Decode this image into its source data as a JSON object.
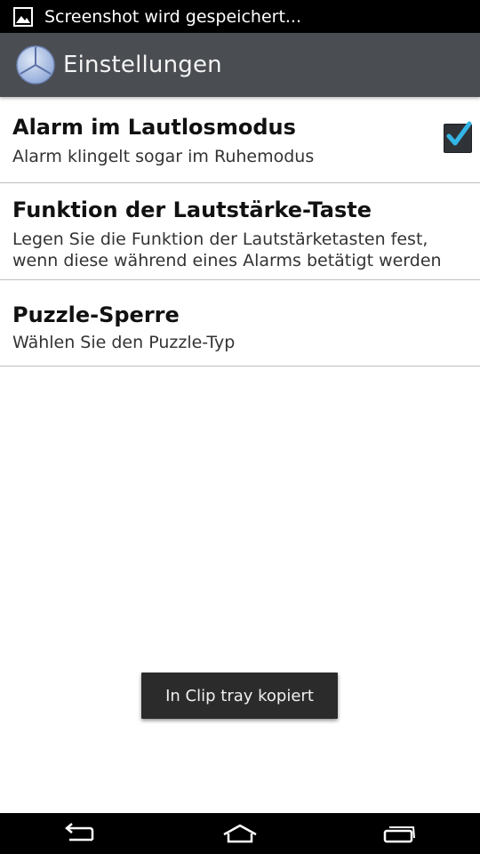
{
  "status_bar": {
    "notification_icon": "image-icon",
    "text": "Screenshot wird gespeichert..."
  },
  "action_bar": {
    "app_icon": "clock-app-icon",
    "title": "Einstellungen"
  },
  "preferences": [
    {
      "title": "Alarm im Lautlosmodus",
      "summary": "Alarm klingelt sogar im Ruhemodus",
      "checked": true
    },
    {
      "title": "Funktion der Lautstärke-Taste",
      "summary": "Legen Sie die Funktion der Lautstärketasten fest, wenn diese während eines Alarms betätigt werden"
    },
    {
      "title": "Puzzle-Sperre",
      "summary": "Wählen Sie den Puzzle-Typ"
    }
  ],
  "toast": {
    "text": "In Clip tray kopiert"
  },
  "nav_bar": {
    "back_icon": "back-icon",
    "home_icon": "home-icon",
    "recents_icon": "recent-apps-icon"
  },
  "colors": {
    "action_bar": "#4a4d52",
    "checkbox_check": "#33b5e5",
    "toast_bg": "#2b2b2b"
  }
}
